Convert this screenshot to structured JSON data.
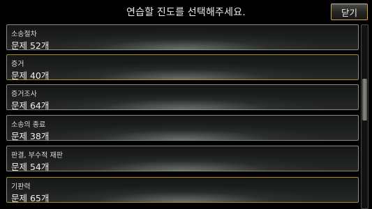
{
  "header": {
    "title": "연습할 진도를 선택해주세요.",
    "close_label": "닫기"
  },
  "items": [
    {
      "title": "소송절차",
      "count": "문제 52개"
    },
    {
      "title": "증거",
      "count": "문제 40개"
    },
    {
      "title": "증거조사",
      "count": "문제 64개"
    },
    {
      "title": "소송의 종료",
      "count": "문제 38개"
    },
    {
      "title": "판결, 부수적 재판",
      "count": "문제 54개"
    },
    {
      "title": "기판력",
      "count": "문제 65개"
    }
  ],
  "scrollbar": {
    "position_fraction": 0.38
  },
  "colors": {
    "border_gold": "#9d8a58",
    "background": "#000000",
    "text": "#f2f2ec"
  }
}
